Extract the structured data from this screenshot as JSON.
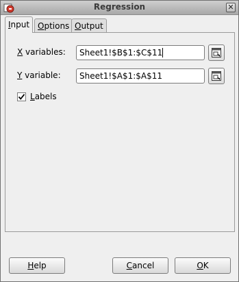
{
  "window": {
    "title": "Regression"
  },
  "tabs": [
    {
      "mnemonic": "I",
      "rest": "nput",
      "active": true
    },
    {
      "mnemonic": "O",
      "rest": "ptions",
      "active": false
    },
    {
      "mnemonic": "O",
      "rest": "utput",
      "active": false
    }
  ],
  "input": {
    "x_label_mnemonic": "X",
    "x_label_rest": " variables:",
    "x_value": "Sheet1!$B$1:$C$11",
    "y_label_mnemonic": "Y",
    "y_label_rest": " variable:",
    "y_value": "Sheet1!$A$1:$A$11",
    "labels_mnemonic": "L",
    "labels_rest": "abels",
    "labels_checked": true
  },
  "buttons": {
    "help_mnemonic": "H",
    "help_rest": "elp",
    "cancel_mnemonic": "C",
    "cancel_rest": "ancel",
    "ok_mnemonic": "O",
    "ok_rest": "K"
  },
  "icons": {
    "app": "regression-app-icon",
    "close": "close-icon",
    "shrink": "shrink-range-icon",
    "check": "checkmark-icon"
  }
}
